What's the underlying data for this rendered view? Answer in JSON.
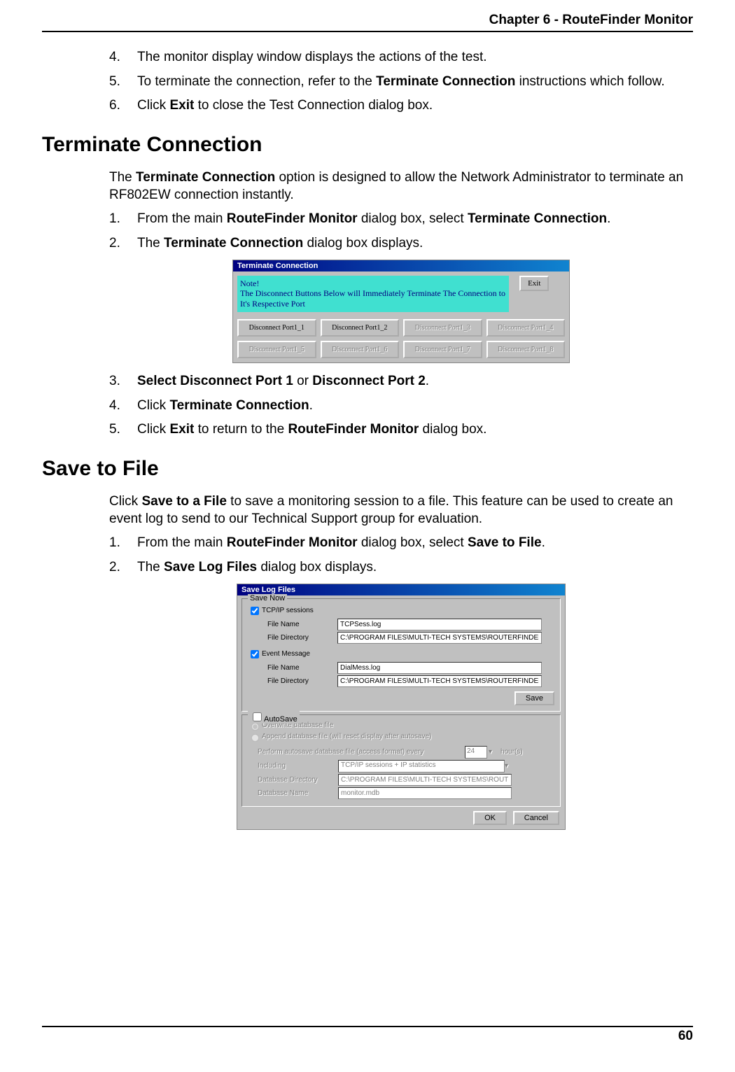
{
  "header": {
    "chapter": "Chapter 6 - RouteFinder Monitor"
  },
  "intro_steps": [
    {
      "num": "4.",
      "text_before": "The monitor display window displays the actions of the test.",
      "bold": "",
      "text_after": ""
    },
    {
      "num": "5.",
      "text_before": "To terminate the connection, refer to the ",
      "bold": "Terminate Connection",
      "text_after": " instructions which follow."
    },
    {
      "num": "6.",
      "text_before": "Click ",
      "bold": "Exit",
      "text_after": " to close the Test Connection dialog box."
    }
  ],
  "section1": {
    "title": "Terminate Connection",
    "intro_before": "The ",
    "intro_bold": "Terminate Connection",
    "intro_after": " option is designed to allow the Network Administrator to terminate an RF802EW connection instantly.",
    "steps_a": [
      {
        "num": "1.",
        "pre": "From the main ",
        "b1": "RouteFinder Monitor",
        "mid": " dialog box, select ",
        "b2": "Terminate Connection",
        "post": "."
      },
      {
        "num": "2.",
        "pre": "The ",
        "b1": "Terminate Connection",
        "mid": " dialog box displays.",
        "b2": "",
        "post": ""
      }
    ],
    "steps_b": [
      {
        "num": "3.",
        "pre": " ",
        "b1": "Select Disconnect Port 1",
        "mid": " or ",
        "b2": "Disconnect Port 2",
        "post": "."
      },
      {
        "num": "4.",
        "pre": "Click ",
        "b1": "Terminate Connection",
        "mid": ".",
        "b2": "",
        "post": ""
      },
      {
        "num": "5.",
        "pre": "Click ",
        "b1": "Exit",
        "mid": " to return to the ",
        "b2": "RouteFinder Monitor",
        "post": " dialog box."
      }
    ]
  },
  "term_dialog": {
    "title": "Terminate Connection",
    "note_l1": "Note!",
    "note_l2": "The Disconnect Buttons Below will Immediately Terminate The Connection to It's Respective Port",
    "exit": "Exit",
    "ports": [
      {
        "label": "Disconnect Port1_1",
        "enabled": true
      },
      {
        "label": "Disconnect Port1_2",
        "enabled": true
      },
      {
        "label": "Disconnect Port1_3",
        "enabled": false
      },
      {
        "label": "Disconnect Port1_4",
        "enabled": false
      },
      {
        "label": "Disconnect Port1_5",
        "enabled": false
      },
      {
        "label": "Disconnect Port1_6",
        "enabled": false
      },
      {
        "label": "Disconnect Port1_7",
        "enabled": false
      },
      {
        "label": "Disconnect Port1_8",
        "enabled": false
      }
    ]
  },
  "section2": {
    "title": "Save to File",
    "intro_before": "Click ",
    "intro_bold": "Save to a File",
    "intro_after": " to save a monitoring session to a file. This feature can be used to create an event log to send to our Technical Support group for evaluation.",
    "steps": [
      {
        "num": "1.",
        "pre": "From the main ",
        "b1": "RouteFinder Monitor",
        "mid": " dialog box, select ",
        "b2": "Save to File",
        "post": "."
      },
      {
        "num": "2.",
        "pre": "The ",
        "b1": "Save Log Files",
        "mid": " dialog box displays.",
        "b2": "",
        "post": ""
      }
    ]
  },
  "save_dialog": {
    "title": "Save Log Files",
    "group1": "Save Now",
    "tcpip": "TCP/IP sessions",
    "file_name": "File Name",
    "file_dir": "File Directory",
    "tcp_fn": "TCPSess.log",
    "tcp_fd": "C:\\PROGRAM FILES\\MULTI-TECH SYSTEMS\\ROUTERFINDER M",
    "event_msg": "Event Message",
    "ev_fn": "DialMess.log",
    "ev_fd": "C:\\PROGRAM FILES\\MULTI-TECH SYSTEMS\\ROUTERFINDER I",
    "save_btn": "Save",
    "group2": "AutoSave",
    "opt1": "Overwrite database file",
    "opt2": "Append database file (will reset display after autosave)",
    "perf": "Perform autosave database file (access format) every",
    "hour_val": "24",
    "hour_lbl": "hour(s)",
    "including": "Including",
    "inc_val": "TCP/IP sessions + IP statistics",
    "db_dir": "Database Directory",
    "db_dir_val": "C:\\PROGRAM FILES\\MULTI-TECH SYSTEMS\\ROUTERFINDER",
    "db_name": "Database Name",
    "db_name_val": "monitor.mdb",
    "ok": "OK",
    "cancel": "Cancel"
  },
  "footer": {
    "page": "60"
  }
}
